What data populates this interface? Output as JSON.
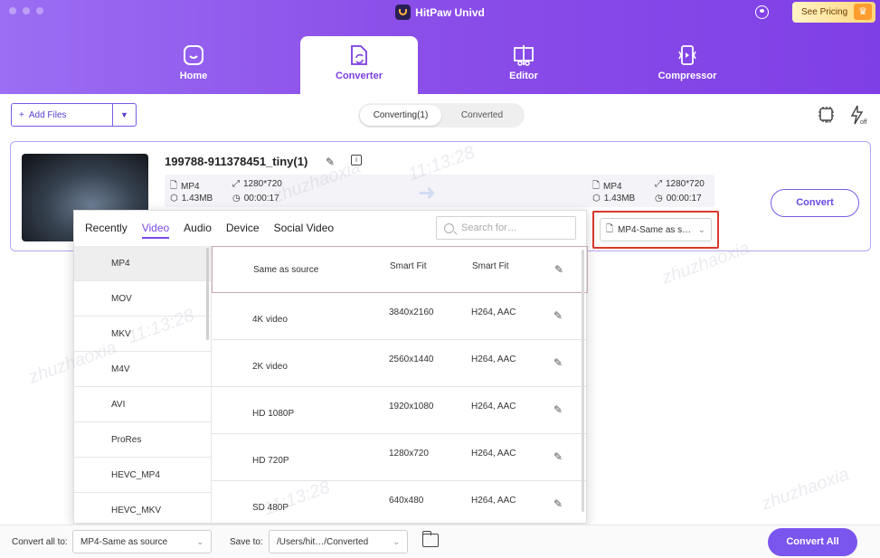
{
  "app": {
    "title": "HitPaw Univd",
    "pricing_label": "See Pricing"
  },
  "nav": [
    {
      "label": "Home",
      "icon": "home-icon"
    },
    {
      "label": "Converter",
      "icon": "converter-icon",
      "active": true
    },
    {
      "label": "Editor",
      "icon": "editor-icon"
    },
    {
      "label": "Compressor",
      "icon": "compressor-icon"
    }
  ],
  "toolbar": {
    "add_files": "Add Files",
    "tabs": [
      {
        "label": "Converting(1)",
        "active": true
      },
      {
        "label": "Converted"
      }
    ]
  },
  "file": {
    "name": "199788-911378451_tiny(1)",
    "source": {
      "format": "MP4",
      "resolution": "1280*720",
      "size": "1.43MB",
      "duration": "00:00:17"
    },
    "target": {
      "format": "MP4",
      "resolution": "1280*720",
      "size": "1.43MB",
      "duration": "00:00:17"
    },
    "output_format": "MP4-Same as s…",
    "convert_label": "Convert"
  },
  "popup": {
    "category_tabs": [
      {
        "label": "Recently"
      },
      {
        "label": "Video",
        "active": true
      },
      {
        "label": "Audio"
      },
      {
        "label": "Device"
      },
      {
        "label": "Social Video"
      }
    ],
    "search_placeholder": "Search for…",
    "formats": [
      "MP4",
      "MOV",
      "MKV",
      "M4V",
      "AVI",
      "ProRes",
      "HEVC_MP4",
      "HEVC_MKV"
    ],
    "selected_format": "MP4",
    "presets": [
      {
        "name": "Same as source",
        "resolution": "Smart Fit",
        "codec": "Smart Fit"
      },
      {
        "name": "4K video",
        "resolution": "3840x2160",
        "codec": "H264, AAC"
      },
      {
        "name": "2K video",
        "resolution": "2560x1440",
        "codec": "H264, AAC"
      },
      {
        "name": "HD 1080P",
        "resolution": "1920x1080",
        "codec": "H264, AAC"
      },
      {
        "name": "HD 720P",
        "resolution": "1280x720",
        "codec": "H264, AAC"
      },
      {
        "name": "SD 480P",
        "resolution": "640x480",
        "codec": "H264, AAC"
      }
    ]
  },
  "footer": {
    "convert_all_to_label": "Convert all to:",
    "convert_all_to_value": "MP4-Same as source",
    "save_to_label": "Save to:",
    "save_to_value": "/Users/hit…/Converted",
    "convert_all_label": "Convert All"
  },
  "watermark": {
    "text": "zhuzhaoxia",
    "time": "11:13:28"
  }
}
